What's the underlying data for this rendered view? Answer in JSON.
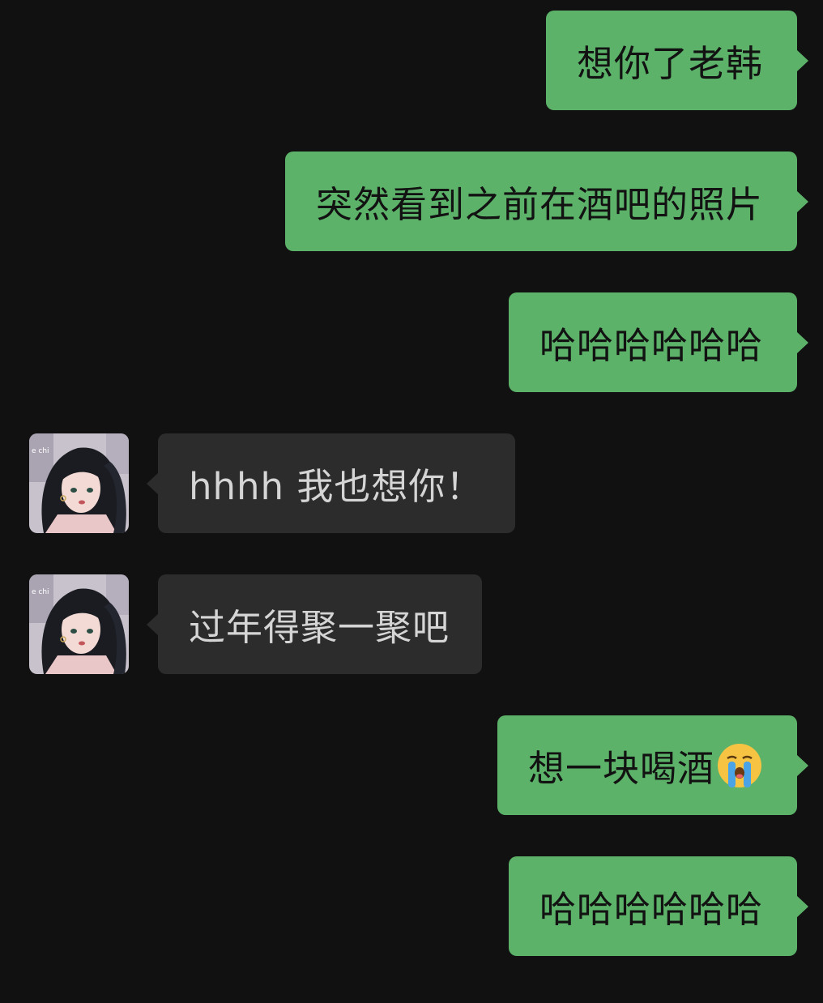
{
  "colors": {
    "background": "#111111",
    "outgoing_bubble": "#5cb269",
    "incoming_bubble": "#2c2c2c",
    "outgoing_text": "#121212",
    "incoming_text": "#d5d5d5"
  },
  "contact": {
    "avatar_icon": "anime-girl-avatar",
    "avatar_caption": "e chi"
  },
  "messages": [
    {
      "direction": "outgoing",
      "text": "想你了老韩"
    },
    {
      "direction": "outgoing",
      "text": "突然看到之前在酒吧的照片"
    },
    {
      "direction": "outgoing",
      "text": "哈哈哈哈哈哈"
    },
    {
      "direction": "incoming",
      "text": "hhhh 我也想你！"
    },
    {
      "direction": "incoming",
      "text": "过年得聚一聚吧"
    },
    {
      "direction": "outgoing",
      "text": "想一块喝酒",
      "emoji": "loudly-crying-face-icon"
    },
    {
      "direction": "outgoing",
      "text": "哈哈哈哈哈哈"
    }
  ]
}
